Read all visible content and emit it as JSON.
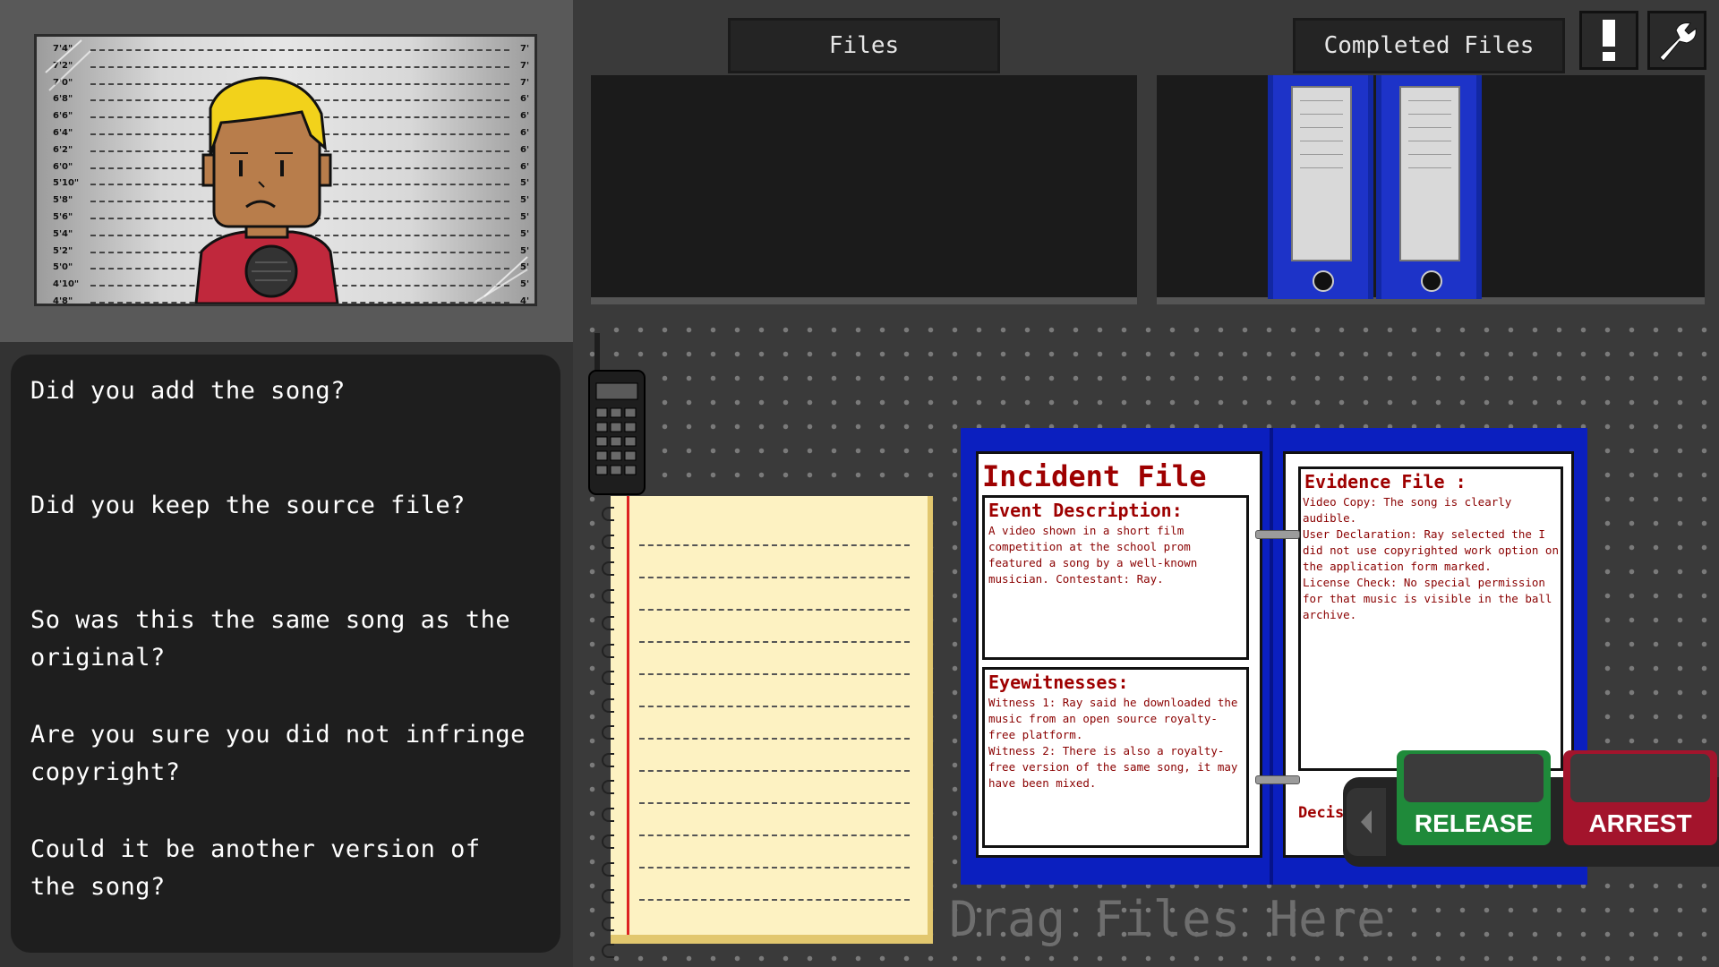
{
  "mugshot": {
    "height_marks": [
      "7'4\"",
      "7'2\"",
      "7'0\"",
      "6'8\"",
      "6'6\"",
      "6'4\"",
      "6'2\"",
      "6'0\"",
      "5'10\"",
      "5'8\"",
      "5'6\"",
      "5'4\"",
      "5'2\"",
      "5'0\"",
      "4'10\"",
      "4'8\""
    ],
    "right_marks": [
      "7'",
      "7'",
      "7'",
      "6'",
      "6'",
      "6'",
      "6'",
      "6'",
      "5'",
      "5'",
      "5'",
      "5'",
      "5'",
      "5'",
      "5'",
      "4'"
    ],
    "colors": {
      "hair": "#f2d21b",
      "skin": "#b87d4b",
      "shirt": "#c0283c",
      "mic": "#333333"
    }
  },
  "questions": [
    "Did you add the song?",
    "Did you keep the source file?",
    "So was this the same song as the original?",
    "Are you sure you did not infringe copyright?",
    "Could it be another version of the song?"
  ],
  "tabs": {
    "files": "Files",
    "completed": "Completed Files"
  },
  "toolbar": {
    "alert_icon": "exclamation-icon",
    "settings_icon": "wrench-icon"
  },
  "incident_file": {
    "title": "Incident File",
    "event_heading": "Event Description:",
    "event_text": "A video shown in a short film competition at the school prom featured a song by a well-known musician. Contestant: Ray.",
    "eyewitness_heading": "Eyewitnesses:",
    "eyewitness_text": "Witness 1: Ray said he downloaded the music from an open source royalty-free platform.\nWitness 2: There is also a royalty-free version of the same song, it may have been mixed.",
    "evidence_heading": "Evidence File :",
    "evidence_text": "Video Copy: The song is clearly audible.\nUser Declaration: Ray selected the I did not use copyrighted work option on the application form marked.\nLicense Check: No special permission for that music is visible in the ball archive.",
    "decision_peek": "Decis"
  },
  "drag_hint": "Drag Files Here",
  "decision": {
    "release": "RELEASE",
    "arrest": "ARREST",
    "release_color": "#1f8a3a",
    "arrest_color": "#a3142c"
  },
  "colors": {
    "binder": "#1d33c8",
    "folder": "#0b1fbf",
    "notepad": "#fdf2c2"
  }
}
